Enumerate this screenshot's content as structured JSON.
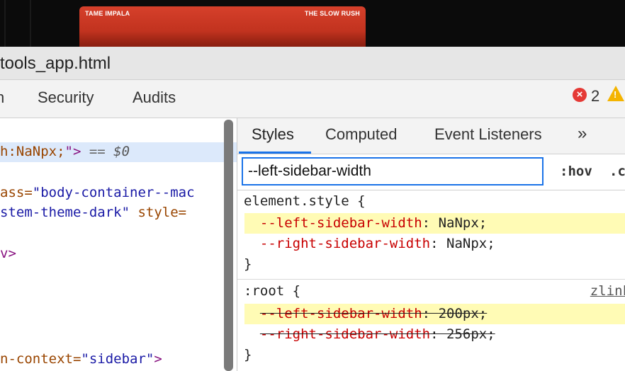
{
  "background": {
    "album": {
      "artist": "TAME IMPALA",
      "title": "THE SLOW RUSH"
    }
  },
  "window": {
    "title": "tools_app.html"
  },
  "main_tabs": [
    {
      "label": "n"
    },
    {
      "label": "Security"
    },
    {
      "label": "Audits"
    }
  ],
  "status": {
    "error_count": "2",
    "error_icon": "error-circle-icon",
    "warning_icon": "warning-triangle-icon"
  },
  "elements": {
    "lines": [
      {
        "parts": [
          "h:NaNpx;",
          "\">",
          " == ",
          "$0"
        ]
      },
      {
        "parts": [
          "ass=",
          "\"body-container--mac"
        ]
      },
      {
        "parts": [
          "stem-theme-dark\"",
          " style="
        ]
      },
      {
        "parts": [
          "v>"
        ]
      },
      {
        "parts": [
          "n-context=",
          "\"sidebar\"",
          ">"
        ]
      }
    ]
  },
  "styles_panel": {
    "tabs": [
      {
        "label": "Styles",
        "active": true
      },
      {
        "label": "Computed"
      },
      {
        "label": "Event Listeners"
      }
    ],
    "more_label": "»",
    "filter": {
      "value": "--left-sidebar-width"
    },
    "hov_label": ":hov",
    "cls_label": ".cls",
    "rules": [
      {
        "selector": "element.style {",
        "declarations": [
          {
            "name": "--left-sidebar-width",
            "value": "NaNpx",
            "highlighted": true,
            "overridden": false
          },
          {
            "name": "--right-sidebar-width",
            "value": "NaNpx",
            "highlighted": false,
            "overridden": false
          }
        ],
        "close": "}"
      },
      {
        "selector": ":root {",
        "source": "zlink",
        "declarations": [
          {
            "name": "--left-sidebar-width",
            "value": "200px",
            "highlighted": true,
            "overridden": true
          },
          {
            "name": "--right-sidebar-width",
            "value": "256px",
            "highlighted": false,
            "overridden": true
          }
        ],
        "close": "}"
      }
    ]
  }
}
